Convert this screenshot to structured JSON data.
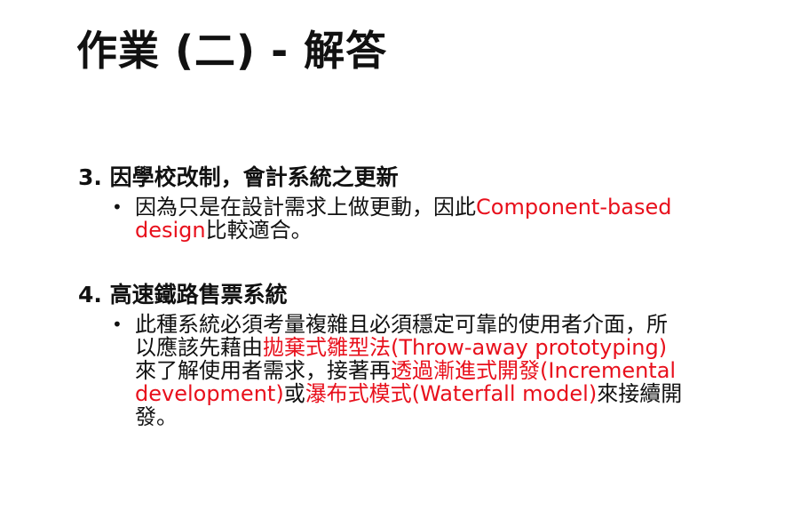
{
  "slide": {
    "title": "作業 (二) - 解答",
    "bullet_symbol": "•",
    "accent_color": "#e8101c",
    "sections": [
      {
        "heading": "3. 因學校改制，會計系統之更新",
        "bullet": {
          "line1_a": "因為只是在設計需求上做更動，因此",
          "line1_red": "Component-based",
          "line2_red": "design",
          "line2_b": "比較適合。"
        }
      },
      {
        "heading": "4. 高速鐵路售票系統",
        "bullet": {
          "line1": "此種系統必須考量複雜且必須穩定可靠的使用者介面，所",
          "line2_a": "以應該先藉由",
          "line2_red": "拋棄式雛型法(Throw-away prototyping)",
          "line3_a": "來了解使用者需求，接著再",
          "line3_red": "透過漸進式開發(Incremental",
          "line4_red1": "development)",
          "line4_b": "或",
          "line4_red2": "瀑布式模式(Waterfall model)",
          "line4_c": "來接續開",
          "line5": "發。"
        }
      }
    ]
  }
}
